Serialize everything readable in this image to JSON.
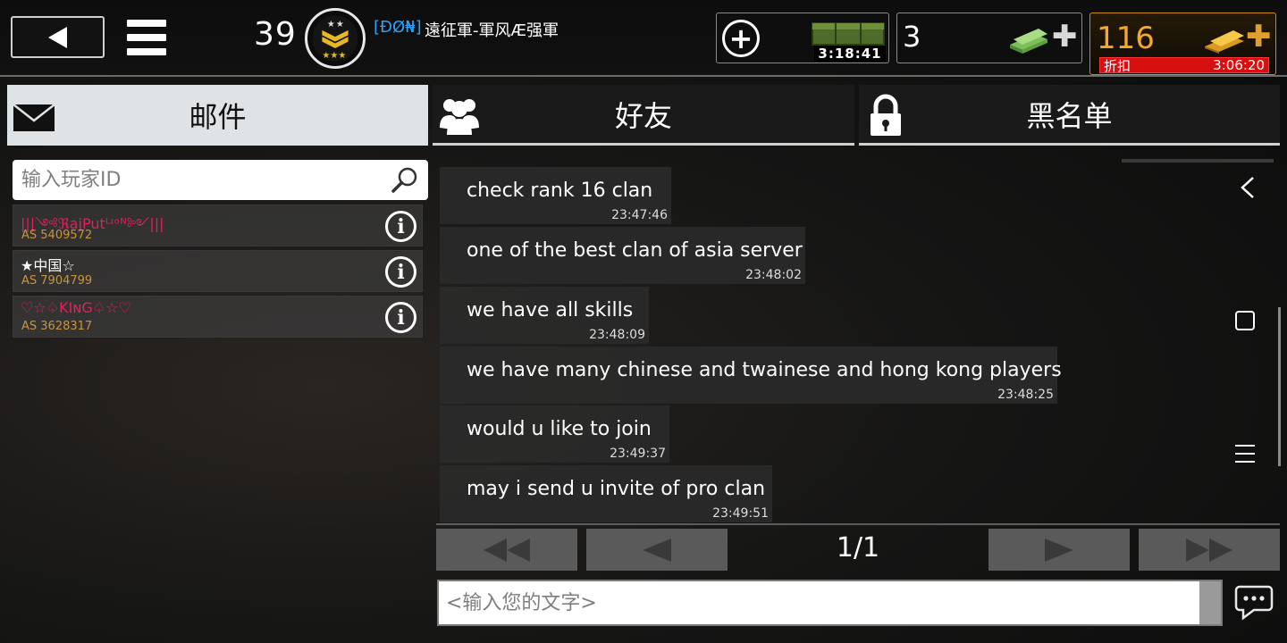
{
  "header": {
    "level": "39",
    "clan_tag": "[ĐØ₦]",
    "player_name": "遠征軍-軍风Æ强軍",
    "crate_timer": "3:18:41",
    "cash_count": "3",
    "gold_count": "116",
    "discount_label": "折扣",
    "discount_timer": "3:06:20"
  },
  "tabs": [
    {
      "label": "邮件",
      "icon": "envelope-icon"
    },
    {
      "label": "好友",
      "icon": "friends-icon"
    },
    {
      "label": "黑名单",
      "icon": "lock-icon"
    }
  ],
  "search": {
    "placeholder": "输入玩家ID"
  },
  "players": [
    {
      "name": "|||༺ℜajPutᴸᶦᵒᴺ༻|||",
      "id": "AS 5409572",
      "color": "#e0205a"
    },
    {
      "name": "★中国☆",
      "id": "AS 7904799",
      "color": "#ffffff"
    },
    {
      "name": "♡☆♤KIɴG♤☆♡",
      "id": "AS 3628317",
      "color": "#e0205a"
    }
  ],
  "messages": [
    {
      "text": "check rank 16 clan",
      "time": "23:47:46"
    },
    {
      "text": "one of the best clan of asia server",
      "time": "23:48:02"
    },
    {
      "text": "we have all skills",
      "time": "23:48:09"
    },
    {
      "text": "we have many chinese and twainese and hong kong players",
      "time": "23:48:25"
    },
    {
      "text": "would u like to join",
      "time": "23:49:37"
    },
    {
      "text": "may i send u invite of pro clan",
      "time": "23:49:51"
    }
  ],
  "pagination": {
    "indicator": "1/1"
  },
  "compose": {
    "placeholder": "<输入您的文字>"
  },
  "colors": {
    "gold": "#f5a92a",
    "clan_tag": "#27a3ff",
    "discount": "#d61010",
    "player_id": "#c8953a"
  }
}
